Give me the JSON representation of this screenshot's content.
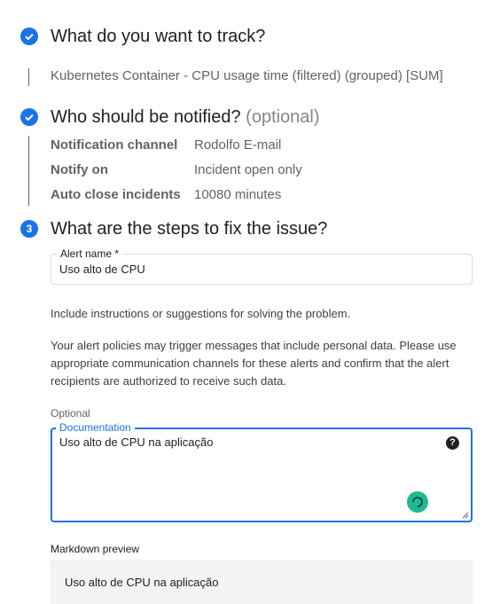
{
  "steps": {
    "track": {
      "title": "What do you want to track?",
      "summary": "Kubernetes Container - CPU usage time (filtered) (grouped) [SUM]"
    },
    "notify": {
      "title": "Who should be notified?",
      "optional": "(optional)",
      "rows": [
        {
          "key": "Notification channel",
          "value": "Rodolfo E-mail"
        },
        {
          "key": "Notify on",
          "value": "Incident open only"
        },
        {
          "key": "Auto close incidents",
          "value": "10080 minutes"
        }
      ]
    },
    "fix": {
      "number": "3",
      "title": "What are the steps to fix the issue?"
    }
  },
  "alert_name": {
    "label": "Alert name *",
    "value": "Uso alto de CPU"
  },
  "instructions_text": "Include instructions or suggestions for solving the problem.",
  "privacy_text": "Your alert policies may trigger messages that include personal data. Please use appropriate communication channels for these alerts and confirm that the alert recipients are authorized to receive such data.",
  "documentation": {
    "optional_label": "Optional",
    "label": "Documentation",
    "value": "Uso alto de CPU na aplicação",
    "help_glyph": "?"
  },
  "markdown_preview": {
    "label": "Markdown preview",
    "content": "Uso alto de CPU na aplicação"
  },
  "colors": {
    "accent": "#1a73e8",
    "spinner": "#1db992"
  },
  "icons": [
    "check-icon",
    "help-icon",
    "spinner-icon",
    "resize-handle-icon"
  ]
}
